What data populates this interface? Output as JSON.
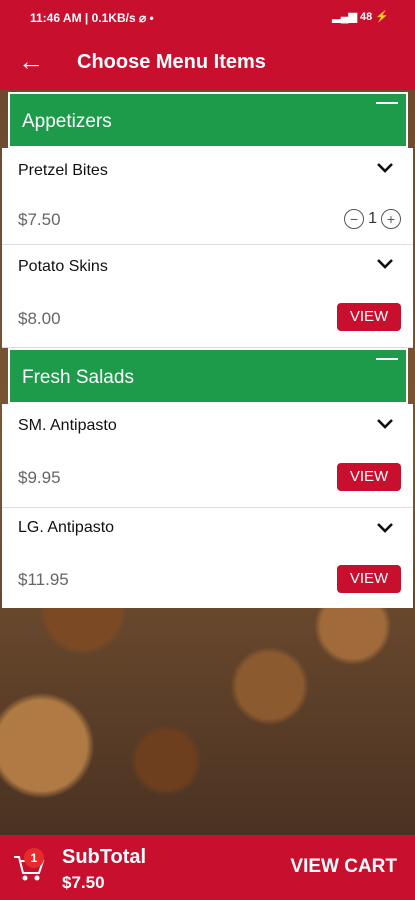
{
  "status": {
    "time": "11:46 AM | 0.1KB/s ⌀ •",
    "right": "▂▄▆ 48 ⚡"
  },
  "header": {
    "title": "Choose Menu Items"
  },
  "sections": [
    {
      "label": "Appetizers"
    },
    {
      "label": "Fresh Salads"
    }
  ],
  "items": [
    {
      "name": "Pretzel Bites",
      "price": "$7.50",
      "quantity": "1"
    },
    {
      "name": "Potato Skins",
      "price": "$8.00",
      "view_label": "VIEW"
    },
    {
      "name": "SM. Antipasto",
      "price": "$9.95",
      "view_label": "VIEW"
    },
    {
      "name": "LG. Antipasto",
      "price": "$11.95",
      "view_label": "VIEW"
    }
  ],
  "cart": {
    "badge": "1",
    "subtotal_label": "SubTotal",
    "subtotal_value": "$7.50",
    "view_cart_label": "VIEW CART"
  },
  "colors": {
    "primary": "#c8102e",
    "section": "#1e9a4b"
  }
}
